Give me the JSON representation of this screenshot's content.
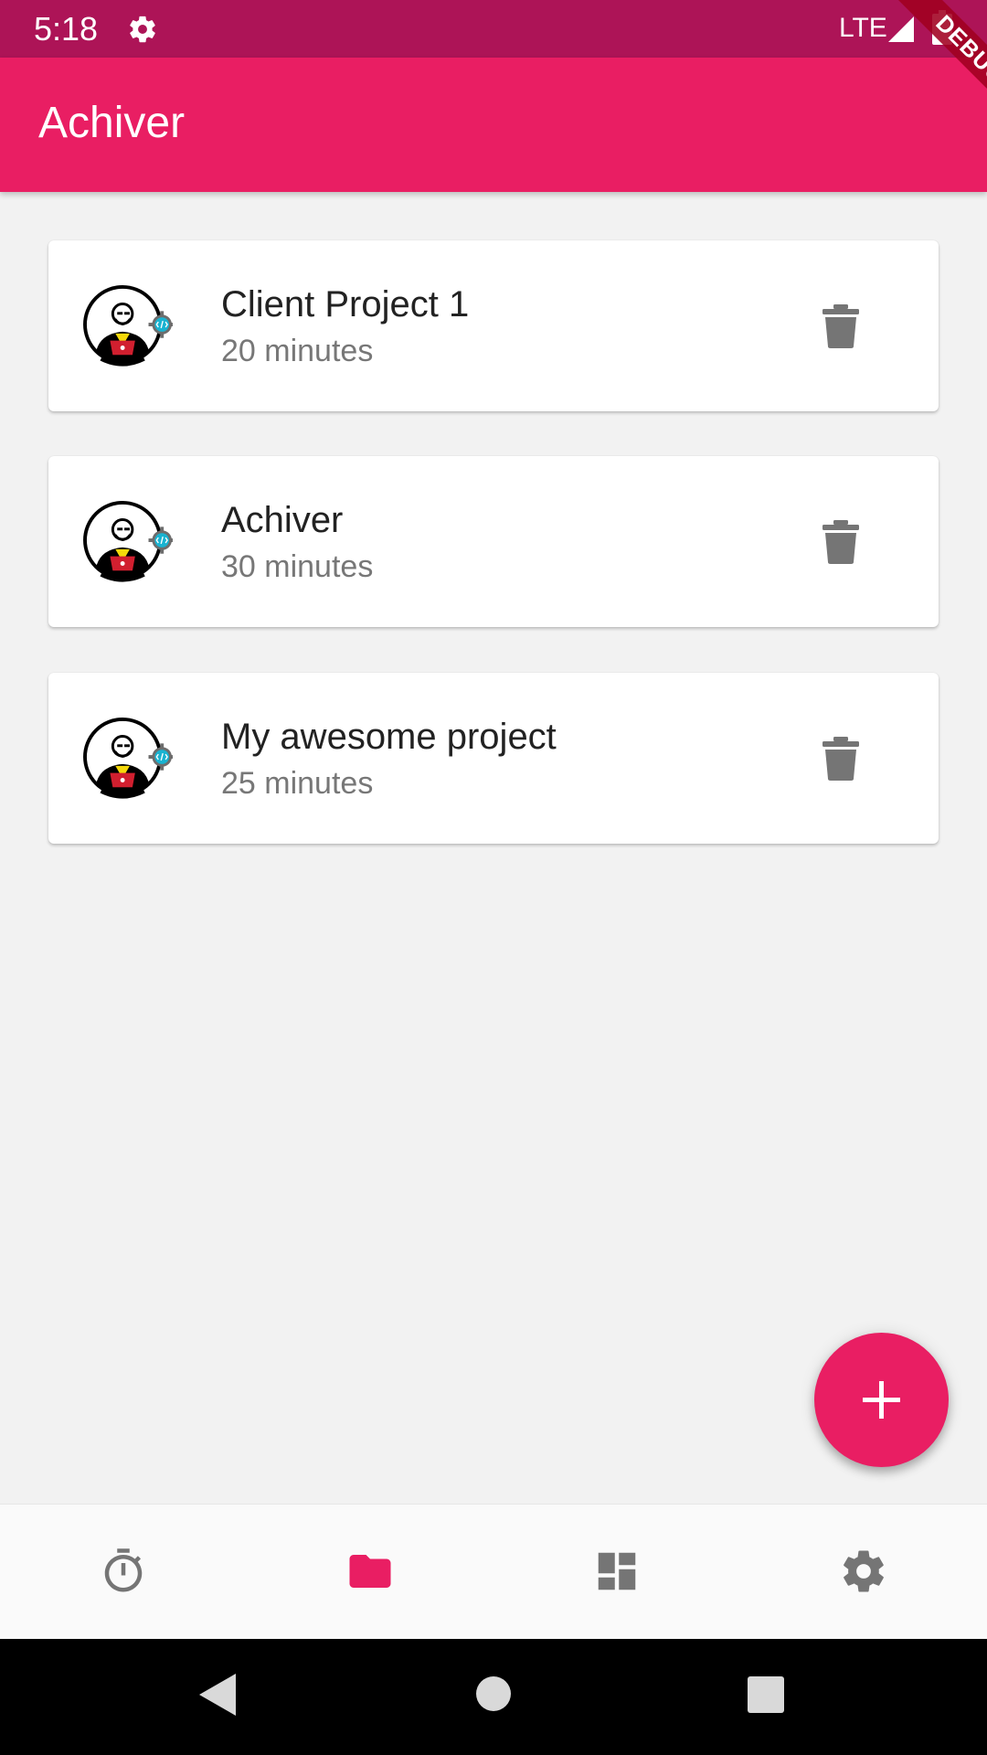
{
  "status_bar": {
    "time": "5:18",
    "network": "LTE",
    "icons": [
      "gear-icon",
      "signal-icon",
      "battery-icon"
    ]
  },
  "app_bar": {
    "title": "Achiver"
  },
  "debug_banner": {
    "label": "DEBUG"
  },
  "projects": [
    {
      "name": "Client Project 1",
      "duration": "20 minutes",
      "avatar_icon": "developer-avatar-icon",
      "action_icon": "trash-icon"
    },
    {
      "name": "Achiver",
      "duration": "30 minutes",
      "avatar_icon": "developer-avatar-icon",
      "action_icon": "trash-icon"
    },
    {
      "name": "My awesome project",
      "duration": "25 minutes",
      "avatar_icon": "developer-avatar-icon",
      "action_icon": "trash-icon"
    }
  ],
  "fab": {
    "icon": "plus-icon"
  },
  "bottom_nav": {
    "items": [
      {
        "icon": "timer-icon",
        "active": false
      },
      {
        "icon": "folder-icon",
        "active": true
      },
      {
        "icon": "dashboard-icon",
        "active": false
      },
      {
        "icon": "settings-icon",
        "active": false
      }
    ]
  },
  "colors": {
    "primary": "#e91e63",
    "primary_dark": "#ad1457",
    "background": "#f2f2f2",
    "icon_inactive": "#757575"
  }
}
